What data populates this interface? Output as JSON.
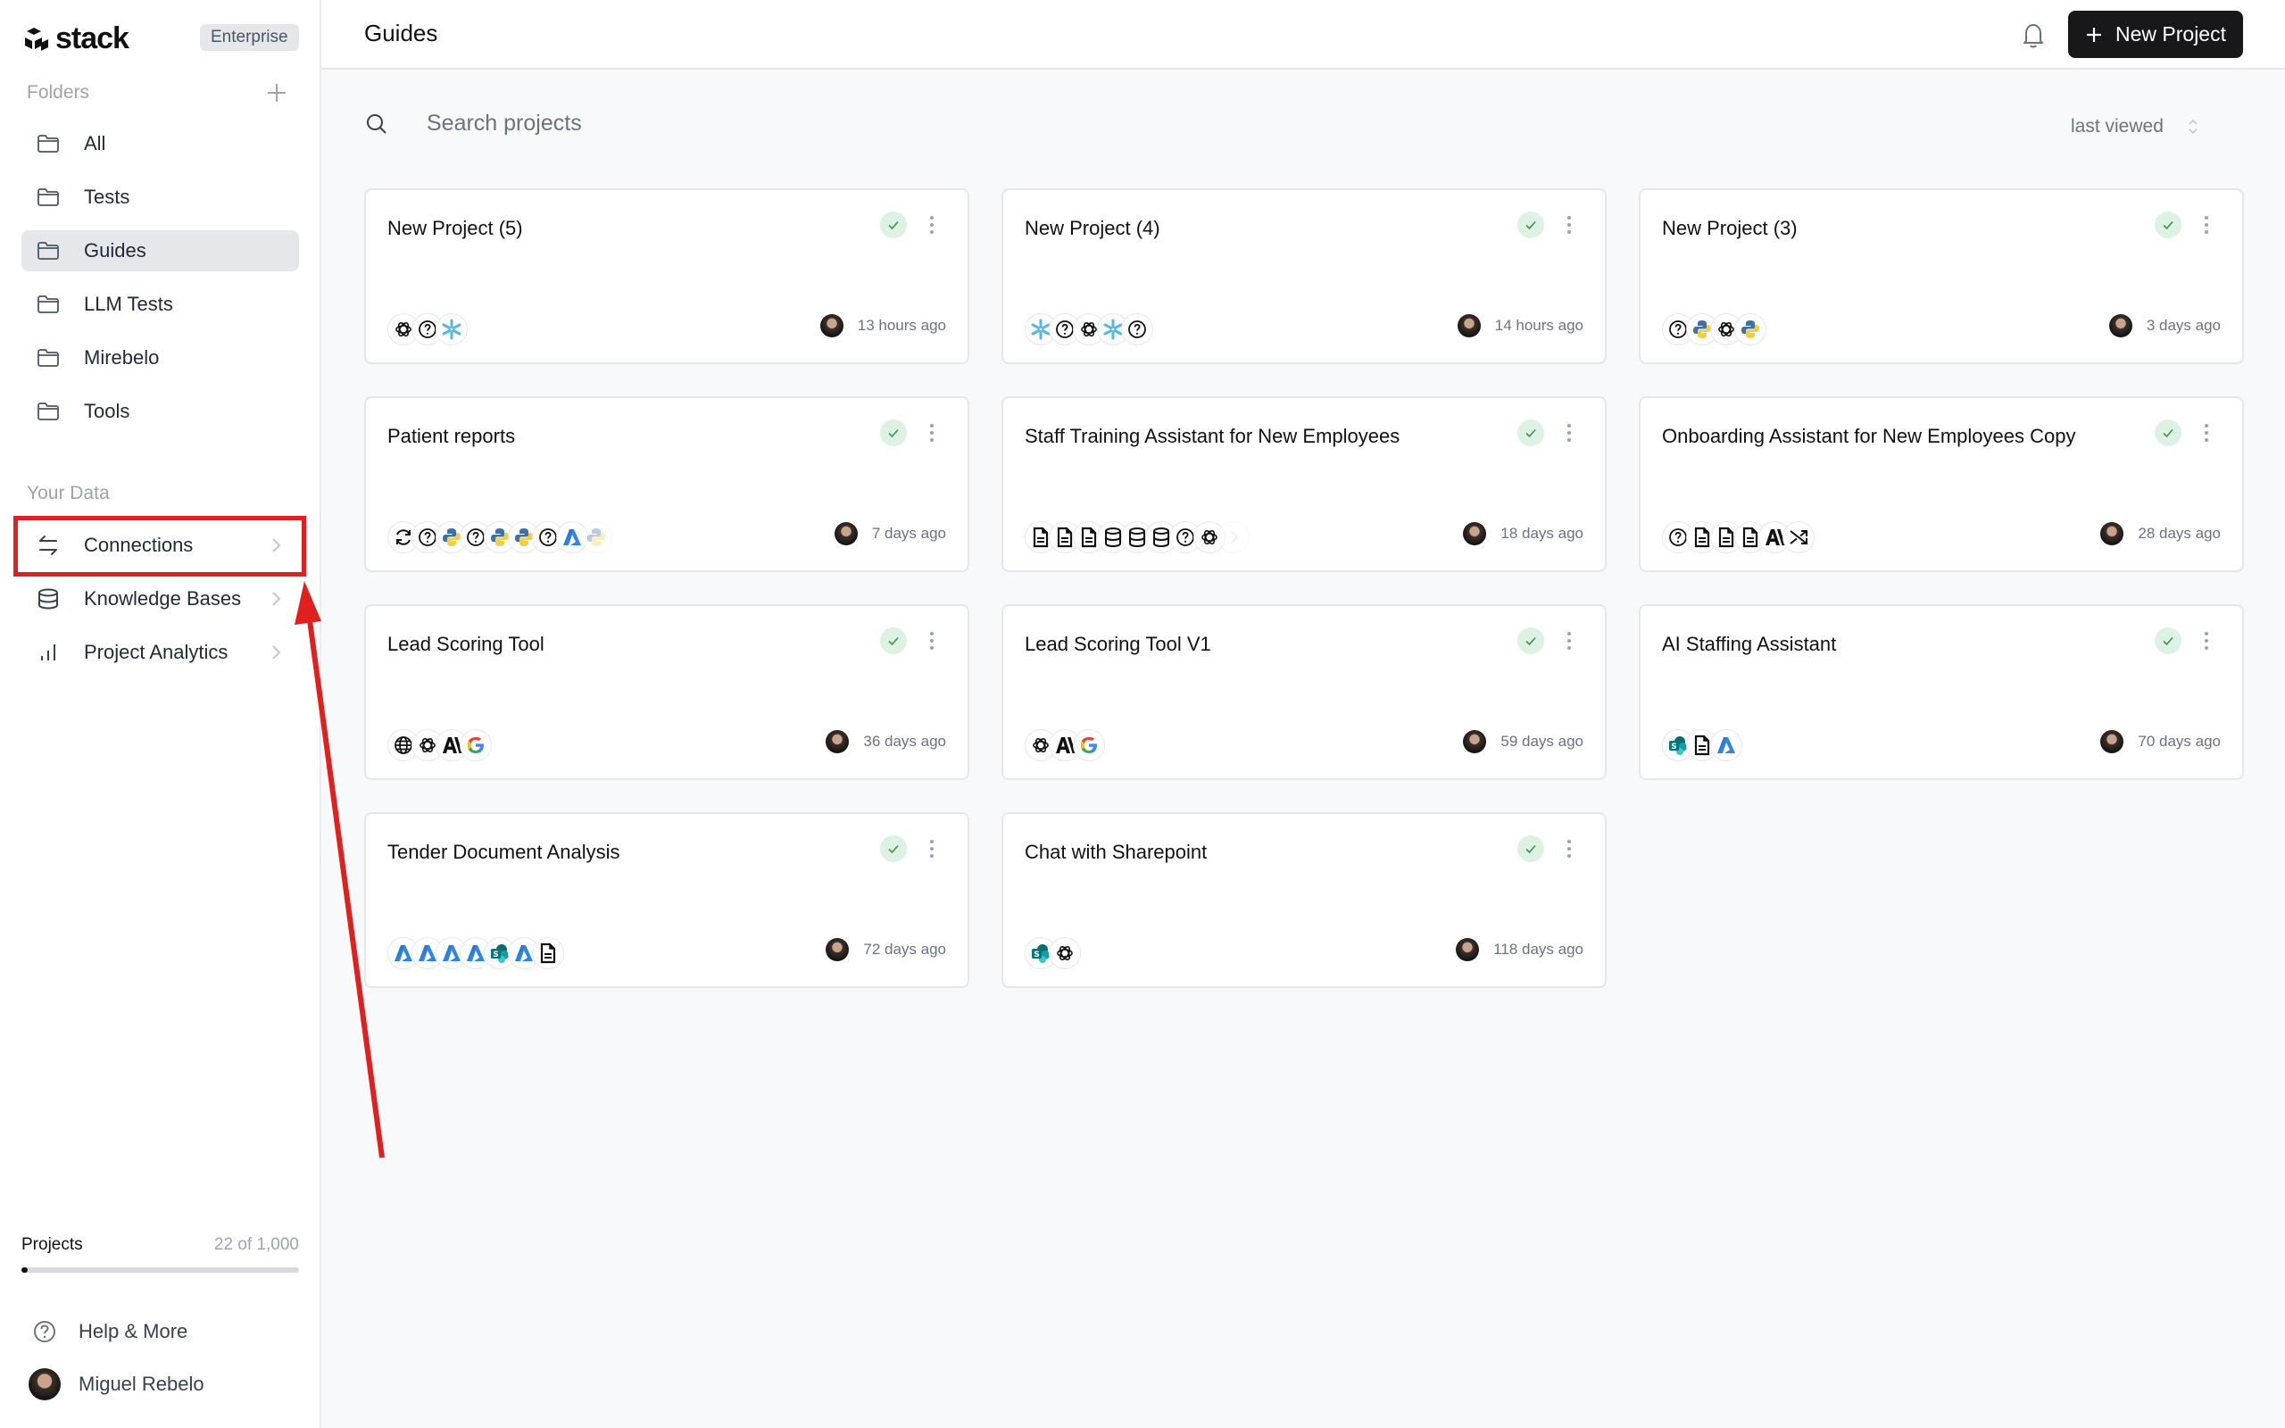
{
  "app": {
    "logo_text": "stack",
    "plan_badge": "Enterprise"
  },
  "sidebar": {
    "folders_label": "Folders",
    "folders": [
      {
        "label": "All",
        "icon": "folder-icon",
        "active": false
      },
      {
        "label": "Tests",
        "icon": "folder-icon",
        "active": false
      },
      {
        "label": "Guides",
        "icon": "folder-icon",
        "active": true
      },
      {
        "label": "LLM Tests",
        "icon": "folder-icon",
        "active": false
      },
      {
        "label": "Mirebelo",
        "icon": "folder-icon",
        "active": false
      },
      {
        "label": "Tools",
        "icon": "folder-icon",
        "active": false
      }
    ],
    "your_data_label": "Your Data",
    "data_items": [
      {
        "label": "Connections",
        "icon": "arrows-exchange-icon"
      },
      {
        "label": "Knowledge Bases",
        "icon": "database-icon"
      },
      {
        "label": "Project Analytics",
        "icon": "bar-chart-icon"
      }
    ],
    "usage": {
      "label": "Projects",
      "count_text": "22 of 1,000",
      "used": 22,
      "limit": 1000
    },
    "help_label": "Help & More",
    "user_name": "Miguel Rebelo"
  },
  "header": {
    "title": "Guides",
    "new_project_label": "New Project"
  },
  "toolbar": {
    "search_placeholder": "Search projects",
    "sort_value": "last viewed"
  },
  "projects": [
    {
      "title": "New Project (5)",
      "time": "13 hours ago",
      "integrations": [
        "openai",
        "unknown",
        "snowflake"
      ]
    },
    {
      "title": "New Project (4)",
      "time": "14 hours ago",
      "integrations": [
        "snowflake",
        "unknown",
        "openai",
        "snowflake",
        "unknown"
      ]
    },
    {
      "title": "New Project (3)",
      "time": "3 days ago",
      "integrations": [
        "unknown",
        "python",
        "openai",
        "python"
      ]
    },
    {
      "title": "Patient reports",
      "time": "7 days ago",
      "integrations": [
        "refresh",
        "unknown",
        "python",
        "unknown",
        "python",
        "python",
        "unknown",
        "azure",
        "python-faded"
      ]
    },
    {
      "title": "Staff Training Assistant for New Employees",
      "time": "18 days ago",
      "integrations": [
        "document",
        "document",
        "document",
        "database",
        "database",
        "database",
        "unknown",
        "openai",
        "more"
      ]
    },
    {
      "title": "Onboarding Assistant for New Employees Copy",
      "time": "28 days ago",
      "integrations": [
        "unknown",
        "document",
        "document",
        "document",
        "anthropic",
        "shuffle"
      ]
    },
    {
      "title": "Lead Scoring Tool",
      "time": "36 days ago",
      "integrations": [
        "globe",
        "openai",
        "anthropic",
        "google"
      ]
    },
    {
      "title": "Lead Scoring Tool V1",
      "time": "59 days ago",
      "integrations": [
        "openai",
        "anthropic",
        "google"
      ]
    },
    {
      "title": "AI Staffing Assistant",
      "time": "70 days ago",
      "integrations": [
        "sharepoint",
        "document",
        "azure"
      ]
    },
    {
      "title": "Tender Document Analysis",
      "time": "72 days ago",
      "integrations": [
        "azure",
        "azure",
        "azure",
        "azure",
        "sharepoint",
        "azure",
        "document"
      ]
    },
    {
      "title": "Chat with Sharepoint",
      "time": "118 days ago",
      "integrations": [
        "sharepoint",
        "openai"
      ]
    }
  ],
  "colors": {
    "accent": "#18181b",
    "status_bg": "#dcf2e3",
    "status_check": "#3f8f5a",
    "annotation": "#e0201f"
  }
}
